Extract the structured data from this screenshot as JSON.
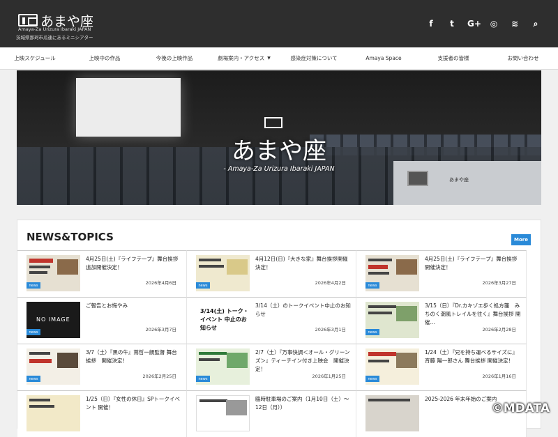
{
  "header": {
    "title": "あまや座",
    "subtitle_en": "Amaya-Za Urizura Ibaraki JAPAN",
    "subtitle_jp": "茨城県那珂市瓜連にあるミニシアター"
  },
  "social": [
    {
      "name": "facebook-icon",
      "glyph": "f"
    },
    {
      "name": "twitter-icon",
      "glyph": "t"
    },
    {
      "name": "google-plus-icon",
      "glyph": "G+"
    },
    {
      "name": "instagram-icon",
      "glyph": "◎"
    },
    {
      "name": "rss-icon",
      "glyph": "≋"
    },
    {
      "name": "search-icon",
      "glyph": "⌕"
    }
  ],
  "nav": [
    {
      "label": "上映スケジュール"
    },
    {
      "label": "上映中の作品"
    },
    {
      "label": "今後の上映作品"
    },
    {
      "label": "劇場案内・アクセス",
      "caret": "▼"
    },
    {
      "label": "感染症対策について"
    },
    {
      "label": "Amaya Space"
    },
    {
      "label": "支援者の皆様"
    },
    {
      "label": "お問い合わせ"
    }
  ],
  "hero": {
    "title": "あまや座",
    "subtitle": "- Amaya-Za Urizura Ibaraki JAPAN",
    "booth_label": "あまや座"
  },
  "news": {
    "heading": "NEWS&TOPICS",
    "more_label": "More",
    "badge": "news",
    "items": [
      {
        "title": "4月25日(土)『ライフテープ』舞台挨拶 追加開催決定！",
        "date": "2026年4月6日",
        "thumb": "ライフテープ 追加舞台挨拶"
      },
      {
        "title": "4月12日(日)『大きな家』舞台挨拶開催決定！",
        "date": "2026年4月2日",
        "thumb": "『大きな家』4/12(日)舞台挨拶"
      },
      {
        "title": "4月25日(土)『ライフテープ』舞台挨拶 開催決定！",
        "date": "2026年3月27日",
        "thumb": "『ライフテープ』4/25(土)舞台挨拶"
      },
      {
        "title": "ご報告とお悔やみ",
        "date": "2026年3月7日",
        "thumb": "NO IMAGE"
      },
      {
        "title": "3/14（土）のトークイベント中止のお知らせ",
        "date": "2026年3月1日",
        "thumb": "3/14(土) トーク・イベント 中止のお知らせ"
      },
      {
        "title": "3/15（日）『Dr.カキゾエ歩く処方箋　みちのく潮風トレイルを往く』舞台挨拶 開催…",
        "date": "2026年2月28日",
        "thumb": "3/15(日) 舞台挨拶"
      },
      {
        "title": "3/7（土）『黒の牛』蔦哲一朗監督 舞台挨拶　開催決定！",
        "date": "2026年2月25日",
        "thumb": "「黒の牛」3/7(土) 蔦哲一朗監督"
      },
      {
        "title": "2/7（土）『万事快調＜オール・グリーンズ＞』ティーチイン付き上映会　開催決定！",
        "date": "2026年1月25日",
        "thumb": "『万事快調』2/7(土) ティーチイン"
      },
      {
        "title": "1/24（土）『兄を持ち運べるサイズに』斉藤 陽一郎さん 舞台挨拶 開催決定！",
        "date": "2026年1月16日",
        "thumb": "『兄を持ち運べるサイズに』1/24(土) 斉藤陽一郎さん"
      },
      {
        "title": "1/25（日）『女性の休日』SPトークイベント 開催！",
        "date": "",
        "thumb": "女性の休日 1/25(日) SPトーク"
      },
      {
        "title": "臨時駐車場のご案内（1月10日（土）〜12日（月））",
        "date": "",
        "thumb": ""
      },
      {
        "title": "2025-2026 年末年始のご案内",
        "date": "",
        "thumb": ""
      }
    ]
  },
  "copyright": "©MDATA",
  "colors": {
    "header_bg": "#2e2e2e",
    "accent": "#2a8ad8"
  }
}
